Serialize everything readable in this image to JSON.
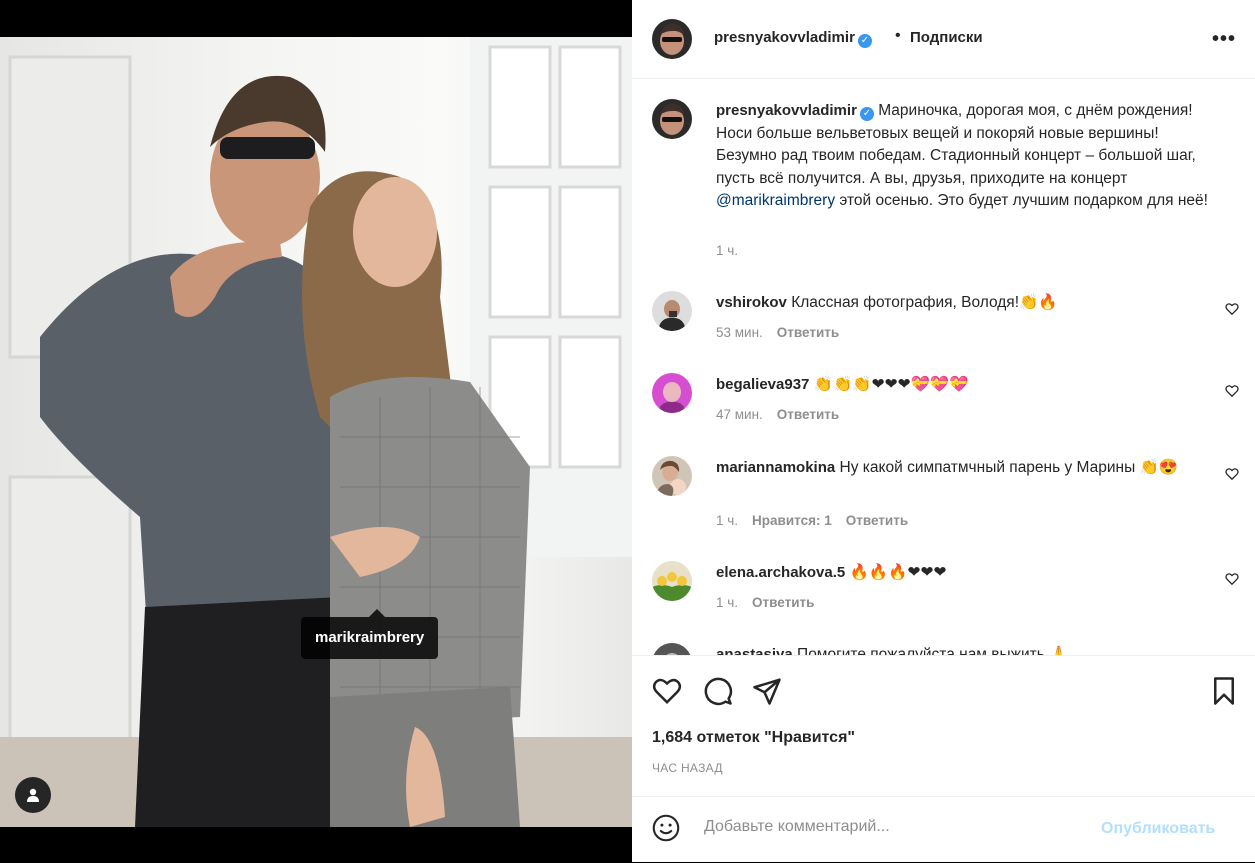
{
  "post": {
    "author": "presnyakovvladimir",
    "follow_status": "Подписки",
    "more_label": "•••",
    "photo_tag": "marikraimbrery",
    "caption_pre": "Мариночка, дорогая моя, с днём рождения! Носи больше вельветовых вещей и покоряй новые вершины! Безумно рад твоим победам. Стадионный концерт – большой шаг, пусть всё получится. А вы, друзья, приходите на концерт ",
    "caption_mention": "@marikraimbrery",
    "caption_post": " этой осенью. Это будет лучшим подарком для неё!",
    "caption_time": "1 ч.",
    "likes_text": "1,684 отметок \"Нравится\"",
    "time_ago": "ЧАС НАЗАД"
  },
  "comments": [
    {
      "user": "vshirokov",
      "text": "Классная фотография, Володя!👏🔥",
      "time": "53 мин.",
      "likes": "",
      "reply": "Ответить"
    },
    {
      "user": "begalieva937",
      "text": "👏👏👏❤❤❤💝💝💝",
      "time": "47 мин.",
      "likes": "",
      "reply": "Ответить"
    },
    {
      "user": "mariannamokina",
      "text": "Ну какой симпатмчный парень у Марины 👏😍",
      "time": "1 ч.",
      "likes": "Нравится: 1",
      "reply": "Ответить"
    },
    {
      "user": "elena.archakova.5",
      "text": "🔥🔥🔥❤❤❤",
      "time": "1 ч.",
      "likes": "",
      "reply": "Ответить"
    },
    {
      "user": "anastasiya",
      "text": "Помогите пожалуйста нам выжить 🙏",
      "time": "",
      "likes": "",
      "reply": ""
    }
  ],
  "comment_box": {
    "placeholder": "Добавьте комментарий...",
    "publish": "Опубликовать"
  },
  "icons": [
    "heart-icon",
    "comment-icon",
    "share-icon",
    "bookmark-icon",
    "emoji-icon",
    "user-tag-icon",
    "verified-icon",
    "more-icon"
  ],
  "colors": {
    "verified": "#3897f0",
    "mention": "#00376b",
    "publish": "#b2dffc",
    "secondary_text": "#8e8e8e"
  }
}
